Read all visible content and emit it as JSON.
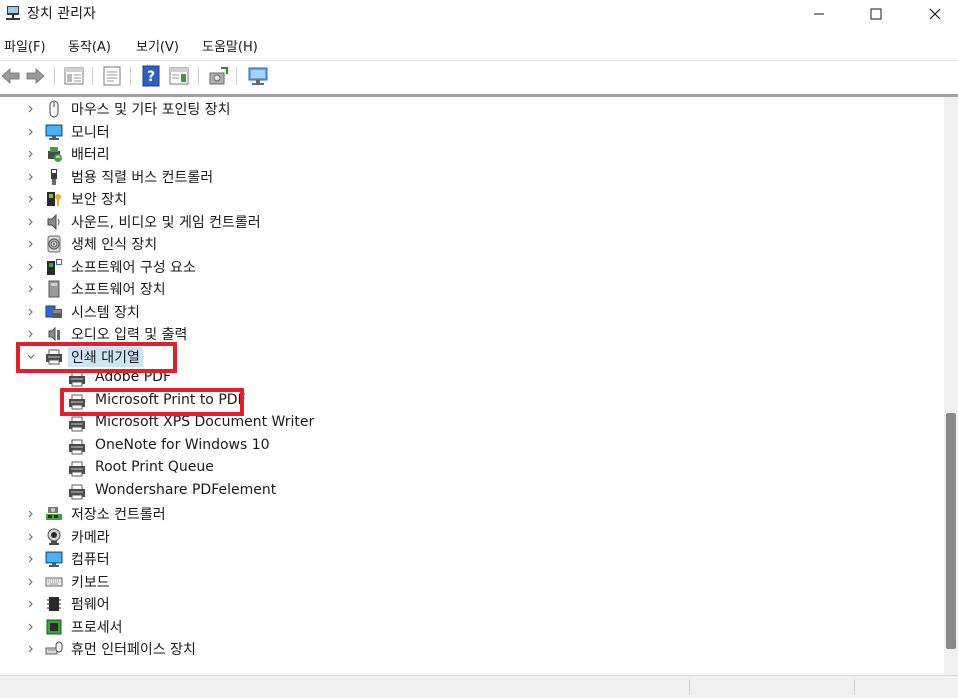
{
  "window": {
    "title": "장치 관리자",
    "controls": {
      "minimize": "minimize-icon",
      "maximize": "maximize-icon",
      "close": "close-icon"
    }
  },
  "menu": [
    "파일(F)",
    "동작(A)",
    "보기(V)",
    "도움말(H)"
  ],
  "toolbar": [
    "back-icon",
    "forward-icon",
    "show-hide-tree-icon",
    "properties-icon",
    "help-icon",
    "action-pane-icon",
    "update-driver-icon",
    "scan-hardware-icon"
  ],
  "tree": {
    "items_before": [
      {
        "label": "마우스 및 기타 포인팅 장치",
        "icon": "mouse-icon"
      },
      {
        "label": "모니터",
        "icon": "monitor-icon"
      },
      {
        "label": "배터리",
        "icon": "battery-icon"
      },
      {
        "label": "범용 직렬 버스 컨트롤러",
        "icon": "usb-icon"
      },
      {
        "label": "보안 장치",
        "icon": "security-device-icon"
      },
      {
        "label": "사운드, 비디오 및 게임 컨트롤러",
        "icon": "speaker-icon"
      },
      {
        "label": "생체 인식 장치",
        "icon": "fingerprint-icon"
      },
      {
        "label": "소프트웨어 구성 요소",
        "icon": "software-component-icon"
      },
      {
        "label": "소프트웨어 장치",
        "icon": "software-device-icon"
      },
      {
        "label": "시스템 장치",
        "icon": "system-device-icon"
      },
      {
        "label": "오디오 입력 및 출력",
        "icon": "audio-io-icon"
      }
    ],
    "expanded": {
      "label": "인쇄 대기열",
      "icon": "printer-icon"
    },
    "children": [
      {
        "label": "Adobe PDF"
      },
      {
        "label": "Microsoft Print to PDF"
      },
      {
        "label": "Microsoft XPS Document Writer"
      },
      {
        "label": "OneNote for Windows 10"
      },
      {
        "label": "Root Print Queue"
      },
      {
        "label": "Wondershare PDFelement"
      }
    ],
    "items_after": [
      {
        "label": "저장소 컨트롤러",
        "icon": "storage-controller-icon"
      },
      {
        "label": "카메라",
        "icon": "camera-icon"
      },
      {
        "label": "컴퓨터",
        "icon": "computer-icon"
      },
      {
        "label": "키보드",
        "icon": "keyboard-icon"
      },
      {
        "label": "펌웨어",
        "icon": "firmware-icon"
      },
      {
        "label": "프로세서",
        "icon": "processor-icon"
      },
      {
        "label": "휴먼 인터페이스 장치",
        "icon": "hid-icon"
      }
    ]
  },
  "colors": {
    "highlight": "#e41e2b",
    "selection": "#cce4f7",
    "scroll_thumb": "#8a8a8a"
  }
}
